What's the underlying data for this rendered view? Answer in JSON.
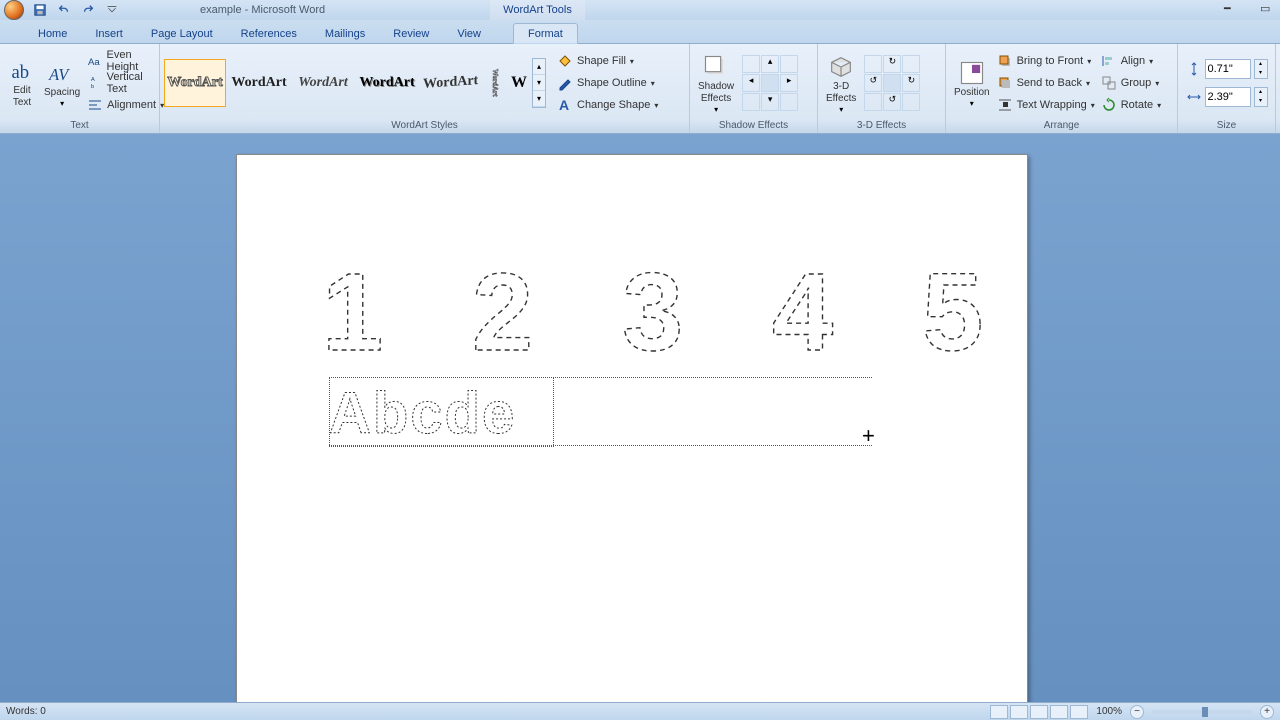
{
  "title": "example - Microsoft Word",
  "contextual_tab_title": "WordArt Tools",
  "tabs": {
    "home": "Home",
    "insert": "Insert",
    "page_layout": "Page Layout",
    "references": "References",
    "mailings": "Mailings",
    "review": "Review",
    "view": "View",
    "format": "Format"
  },
  "groups": {
    "text": {
      "label": "Text",
      "edit_text": "Edit\nText",
      "spacing": "Spacing",
      "even_height": "Even Height",
      "vertical_text": "Vertical Text",
      "alignment": "Alignment"
    },
    "wordart_styles": {
      "label": "WordArt Styles",
      "sample": "WordArt",
      "shape_fill": "Shape Fill",
      "shape_outline": "Shape Outline",
      "change_shape": "Change Shape"
    },
    "shadow": {
      "label": "Shadow Effects",
      "btn": "Shadow\nEffects"
    },
    "three_d": {
      "label": "3-D Effects",
      "btn": "3-D\nEffects"
    },
    "arrange": {
      "label": "Arrange",
      "position": "Position",
      "bring_front": "Bring to Front",
      "send_back": "Send to Back",
      "text_wrap": "Text Wrapping",
      "align": "Align",
      "group": "Group",
      "rotate": "Rotate"
    },
    "size": {
      "label": "Size",
      "height": "0.71\"",
      "width": "2.39\""
    }
  },
  "document": {
    "numbers": [
      "1",
      "2",
      "3",
      "4",
      "5"
    ],
    "letters": "Abcde"
  },
  "status": {
    "words": "Words: 0",
    "zoom": "100%"
  }
}
